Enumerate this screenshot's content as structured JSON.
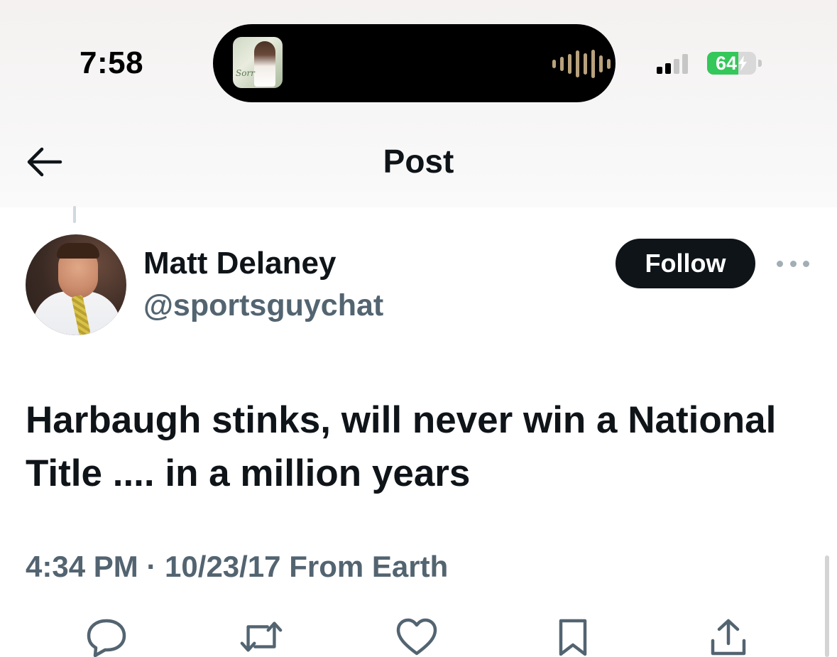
{
  "status_bar": {
    "time": "7:58",
    "battery_level": 64,
    "battery_text": "64",
    "signal_bars_active": 2,
    "signal_bars_total": 4,
    "battery_charging": true,
    "dynamic_island": {
      "activity": "audio-playback",
      "art_script_text": "Sorr",
      "waveform_color": "#b8a27c"
    }
  },
  "nav": {
    "back_icon": "arrow-left-icon",
    "title": "Post"
  },
  "author": {
    "name": "Matt Delaney",
    "handle": "@sportsguychat",
    "follow_label": "Follow",
    "more_icon": "ellipsis-icon"
  },
  "tweet": {
    "text": "Harbaugh stinks, will never win a National Title .... in a million years",
    "meta": "4:34 PM · 10/23/17 From Earth"
  },
  "actions": [
    {
      "name": "reply",
      "icon": "speech-bubble-icon"
    },
    {
      "name": "retweet",
      "icon": "retweet-arrows-icon"
    },
    {
      "name": "like",
      "icon": "heart-icon"
    },
    {
      "name": "bookmark",
      "icon": "bookmark-icon"
    },
    {
      "name": "share",
      "icon": "share-upload-icon"
    }
  ],
  "colors": {
    "primary_text": "#0f1419",
    "secondary_text": "#536471",
    "follow_bg": "#0f1419",
    "battery_green": "#34c759",
    "action_icon": "#536471"
  }
}
